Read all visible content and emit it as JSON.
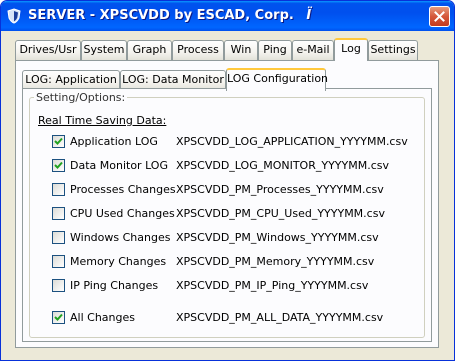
{
  "window": {
    "title": "SERVER - XPSCVDD by ESCAD, Corp.",
    "title_glyph": "Ï"
  },
  "top_tabs": [
    {
      "label": "Drives/Usr"
    },
    {
      "label": "System"
    },
    {
      "label": "Graph"
    },
    {
      "label": "Process"
    },
    {
      "label": "Win"
    },
    {
      "label": "Ping"
    },
    {
      "label": "e-Mail"
    },
    {
      "label": "Log",
      "active": true
    },
    {
      "label": "Settings"
    }
  ],
  "log_tabs": [
    {
      "label": "LOG: Application"
    },
    {
      "label": "LOG: Data Monitor"
    },
    {
      "label": "LOG Configuration",
      "active": true
    }
  ],
  "settings": {
    "group_title": "Setting/Options:",
    "section_title": "Real Time Saving Data:",
    "items": [
      {
        "label": "Application LOG",
        "checked": true,
        "file": "XPSCVDD_LOG_APPLICATION_YYYYMM.csv"
      },
      {
        "label": "Data Monitor LOG",
        "checked": true,
        "file": "XPSCVDD_LOG_MONITOR_YYYYMM.csv"
      },
      {
        "label": "Processes Changes",
        "checked": false,
        "file": "XPSCVDD_PM_Processes_YYYYMM.csv"
      },
      {
        "label": "CPU Used Changes",
        "checked": false,
        "file": "XPSCVDD_PM_CPU_Used_YYYYMM.csv"
      },
      {
        "label": "Windows Changes",
        "checked": false,
        "file": "XPSCVDD_PM_Windows_YYYYMM.csv"
      },
      {
        "label": "Memory Changes",
        "checked": false,
        "file": "XPSCVDD_PM_Memory_YYYYMM.csv"
      },
      {
        "label": "IP Ping Changes",
        "checked": false,
        "file": "XPSCVDD_PM_IP_Ping_YYYYMM.csv"
      },
      {
        "label": "All Changes",
        "checked": true,
        "file": "XPSCVDD_PM_ALL_DATA_YYYYMM.csv"
      }
    ]
  },
  "colors": {
    "titlebar": "#0054E3",
    "tab_highlight": "#FFC83C",
    "face": "#ECE9D8",
    "check": "#21A121"
  },
  "icons": {
    "app": "shield-app-icon",
    "close": "close-icon",
    "check": "checkmark-icon"
  }
}
